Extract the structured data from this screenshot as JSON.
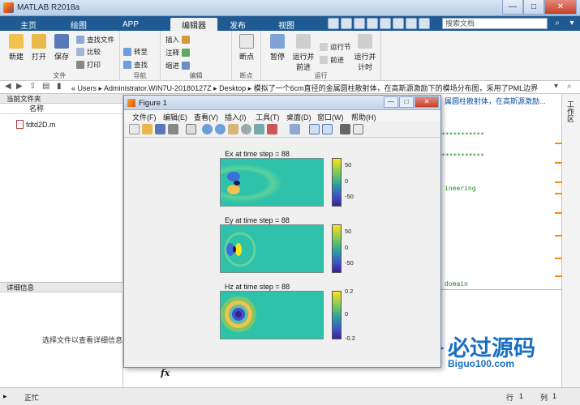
{
  "window": {
    "title": "MATLAB R2018a",
    "minimize": "—",
    "maximize": "□",
    "close": "✕"
  },
  "tabs": [
    {
      "label": "主页"
    },
    {
      "label": "绘图"
    },
    {
      "label": "APP"
    },
    {
      "label": "编辑器"
    },
    {
      "label": "发布"
    },
    {
      "label": "视图"
    }
  ],
  "search": {
    "placeholder": "搜索文档"
  },
  "ribbon": {
    "file": {
      "group": "文件",
      "new": "新建",
      "open": "打开",
      "save": "保存",
      "find_files": "查找文件",
      "compare": "比较",
      "print": "打印"
    },
    "navigate": {
      "group": "导航",
      "goto": "转至",
      "find": "查找"
    },
    "edit": {
      "group": "编辑",
      "insert": "插入",
      "comment": "注释",
      "indent": "缩进"
    },
    "breakpoints": {
      "group": "断点",
      "label": "断点"
    },
    "run": {
      "group": "运行",
      "pause": "暂停",
      "run_advance": "运行并前进",
      "run_section": "运行节",
      "advance": "前进",
      "run_time": "运行并计时"
    }
  },
  "address": {
    "path": "« Users ▸ Administrator.WIN7U-20180127Z ▸ Desktop ▸ 模拟了一个6cm直径的金属圆柱散射体，在高斯源激励下的模场分布图，采用了PML边界"
  },
  "left_panel": {
    "header": "当前文件夹",
    "col_name": "名称",
    "file": "fdtd2D.m",
    "details_header": "详细信息",
    "details_text": "选择文件以查看详细信息"
  },
  "editor_snippets": {
    "line1": "***********",
    "line2": "***********",
    "line3": "ineering",
    "line4": "domain",
    "tab_tail": "属圆柱散射体，在高斯源激励..."
  },
  "command": {
    "prompt": "fx"
  },
  "right_strip": {
    "label": "工作区"
  },
  "figure": {
    "title": "Figure 1",
    "menus": [
      "文件(F)",
      "编辑(E)",
      "查看(V)",
      "插入(I)",
      "工具(T)",
      "桌面(D)",
      "窗口(W)",
      "帮助(H)"
    ],
    "plots": [
      {
        "title": "Ex at time step = 88",
        "ticks": [
          "50",
          "0",
          "-50"
        ]
      },
      {
        "title": "Ey at time step = 88",
        "ticks": [
          "50",
          "0",
          "-50"
        ]
      },
      {
        "title": "Hz at time step = 88",
        "ticks": [
          "0.2",
          "0",
          "-0.2"
        ]
      }
    ]
  },
  "status": {
    "ready": "正忙",
    "row_label": "行",
    "row": "1",
    "col_label": "列",
    "col": "1"
  },
  "watermark": {
    "cn": "必过源码",
    "url": "Biguo100.com"
  },
  "colors": {
    "ribbon_tab_bg": "#1f5a92",
    "field_bg": "#2dc2a9",
    "watermark": "#1a6fc2"
  }
}
